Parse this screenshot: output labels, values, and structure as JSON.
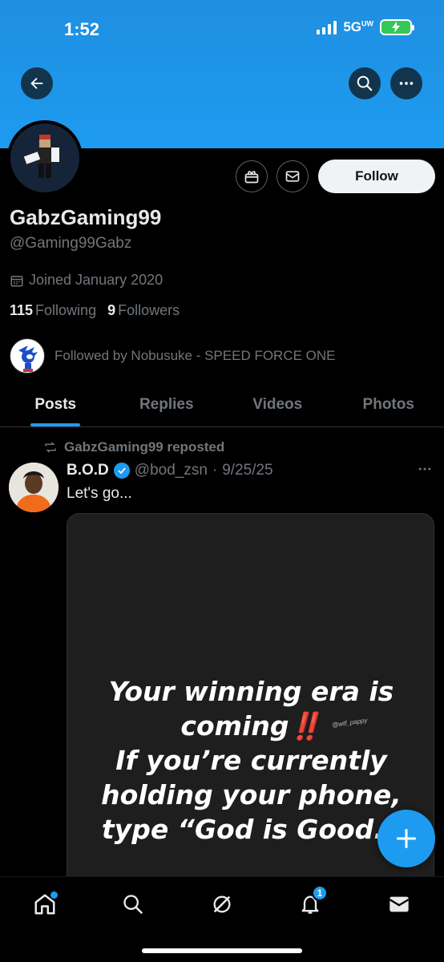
{
  "status_bar": {
    "time": "1:52",
    "network": "5G",
    "network_sup": "UW"
  },
  "header": {
    "back_icon": "back-arrow-icon",
    "search_icon": "search-icon",
    "more_icon": "more-icon"
  },
  "profile": {
    "display_name": "GabzGaming99",
    "handle": "@Gaming99Gabz",
    "joined": "Joined January 2020",
    "following_count": "115",
    "following_label": "Following",
    "followers_count": "9",
    "followers_label": "Followers",
    "followed_by": "Followed by Nobusuke - SPEED FORCE ONE",
    "follow_label": "Follow"
  },
  "tabs": [
    {
      "label": "Posts",
      "active": true
    },
    {
      "label": "Replies",
      "active": false
    },
    {
      "label": "Videos",
      "active": false
    },
    {
      "label": "Photos",
      "active": false
    }
  ],
  "post": {
    "repost_label": "GabzGaming99 reposted",
    "author_name": "B.O.D",
    "author_handle": "@bod_zsn",
    "separator": "·",
    "date": "9/25/25",
    "text": "Let's go...",
    "media": {
      "line1": "Your winning era is",
      "line2": "coming",
      "line2_emoji": "‼️",
      "line3": "If you’re currently",
      "line4": "holding your phone,",
      "line5": "type “God is Good.”",
      "watermark": "@wtf_pappy"
    }
  },
  "bottom_nav": {
    "notification_badge": "1"
  },
  "colors": {
    "accent": "#1d9bf0",
    "background": "#000000",
    "muted": "#71767b",
    "text": "#e7e9ea"
  }
}
